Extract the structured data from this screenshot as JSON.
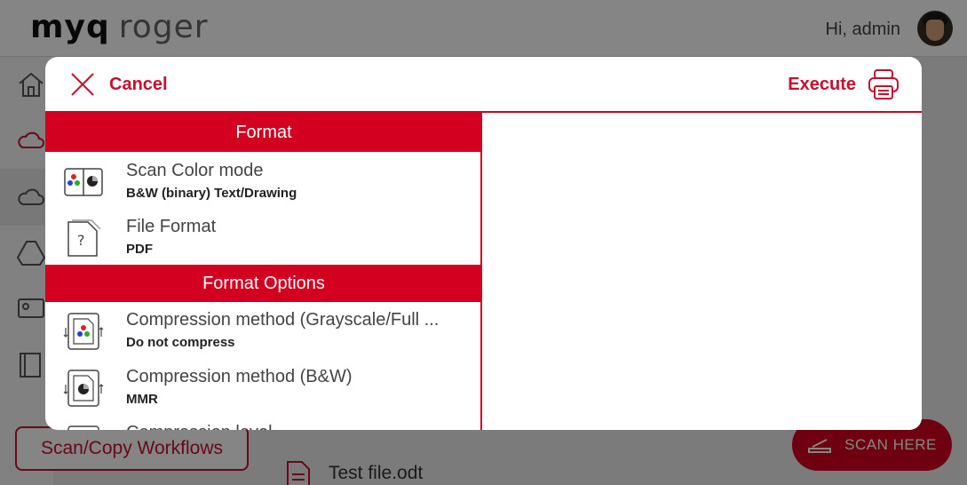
{
  "header": {
    "logo_primary": "myq",
    "logo_secondary": "roger",
    "greeting": "Hi, admin"
  },
  "background": {
    "workflows_button": "Scan/Copy Workflows",
    "file_name": "Test file.odt",
    "scan_button": "SCAN HERE"
  },
  "modal": {
    "cancel_label": "Cancel",
    "execute_label": "Execute",
    "sections": [
      {
        "title": "Format",
        "items": [
          {
            "title": "Scan Color mode",
            "value": "B&W (binary) Text/Drawing"
          },
          {
            "title": "File Format",
            "value": "PDF"
          }
        ]
      },
      {
        "title": "Format Options",
        "items": [
          {
            "title": "Compression method (Grayscale/Full ...",
            "value": "Do not compress"
          },
          {
            "title": "Compression method (B&W)",
            "value": "MMR"
          },
          {
            "title": "Compression level",
            "value": ""
          }
        ]
      }
    ]
  },
  "colors": {
    "accent": "#d4001f",
    "accent_text": "#c8102e"
  }
}
